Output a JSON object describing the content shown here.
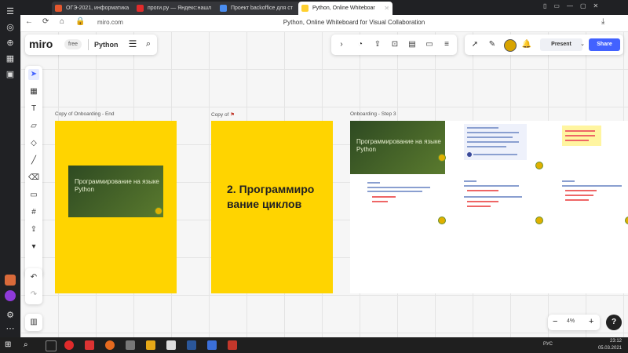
{
  "browser": {
    "tabs": [
      {
        "label": "ОГЭ-2021, информатика",
        "color": "#e4572e"
      },
      {
        "label": "проги.ру — Яндекс:нашл",
        "color": "#e02b2b"
      },
      {
        "label": "Проект backoffice для ст",
        "color": "#4a8df0"
      },
      {
        "label": "Python, Online Whiteboar",
        "color": "#ffd02f"
      }
    ],
    "url": "miro.com",
    "page_title": "Python, Online Whiteboard for Visual Collaboration"
  },
  "miro": {
    "logo": "miro",
    "plan": "free",
    "board_name": "Python",
    "present_label": "Present",
    "share_label": "Share",
    "zoom": "4%"
  },
  "frames": {
    "f1_label": "Copy of Onboarding - End",
    "f2_label": "Copy of",
    "f3_label": "Onboarding - Step 3",
    "slide_title": "Программирование на языке Python",
    "f2_heading": "2. Программиро вание циклов",
    "step3_slide_title": "Программирование на языке Python"
  },
  "taskbar": {
    "time": "23:12",
    "date": "05.03.2021",
    "lang": "РУС"
  },
  "colors": {
    "accent": "#4262ff",
    "frame_yellow": "#ffd400"
  }
}
